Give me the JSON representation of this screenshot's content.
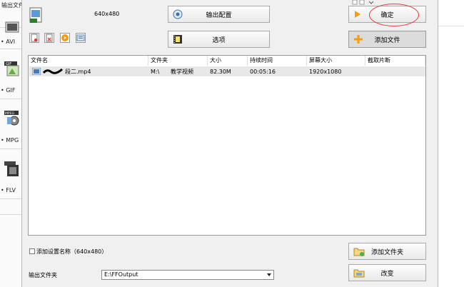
{
  "left_panel": {
    "title": "输出文件",
    "formats": [
      {
        "icon": "avi-icon",
        "label": "• AVI"
      },
      {
        "icon": "gif-icon",
        "label": "• GIF"
      },
      {
        "icon": "mpg-icon",
        "label": "• MPG"
      },
      {
        "icon": "flv-icon",
        "label": "• FLV"
      }
    ]
  },
  "header": {
    "resolution": "640x480",
    "output_config_button": "输出配置",
    "options_button": "选项",
    "ok_button": "确定",
    "add_file_button": "添加文件"
  },
  "file_list": {
    "columns": [
      "文件名",
      "文件夹",
      "大小",
      "持续时间",
      "屏幕大小",
      "截取片断"
    ],
    "rows": [
      {
        "name": "段二.mp4",
        "folder": "M:\\",
        "folder_name": "教学视频",
        "size": "82.30M",
        "duration": "00:05:16",
        "screen": "1920x1080",
        "clip": ""
      }
    ]
  },
  "footer": {
    "add_settings_label": "添加设置名称（640x480）",
    "add_folder_button": "添加文件夹",
    "output_folder_label": "输出文件夹",
    "output_folder_value": "E:\\FFOutput",
    "change_button": "改变"
  },
  "colors": {
    "dialog_bg": "#f0f0f0",
    "annotation_red": "#e53935",
    "add_icon_orange": "#f39c12"
  }
}
